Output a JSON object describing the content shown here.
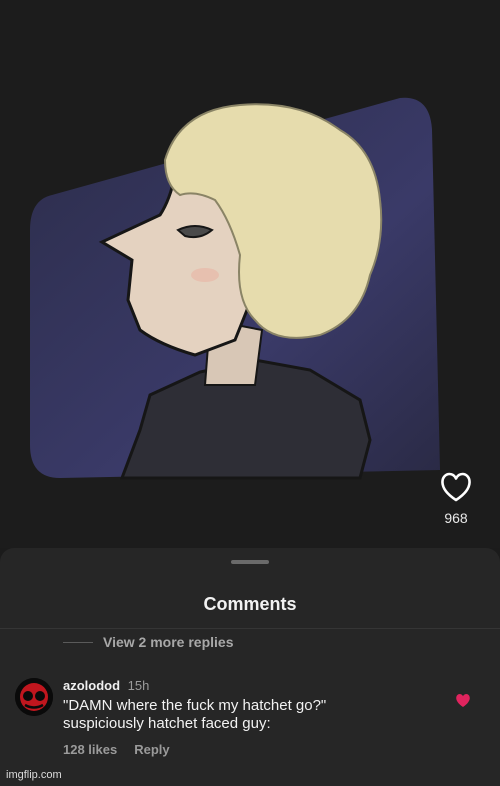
{
  "post": {
    "like_count": "968",
    "like_icon": "heart-outline-icon"
  },
  "comments_sheet": {
    "title": "Comments",
    "view_replies": "View 2 more replies"
  },
  "comment": {
    "username": "azolodod",
    "time": "15h",
    "text": "\"DAMN where the fuck my hatchet go?\"\nsuspiciously hatchet faced guy:",
    "likes": "128 likes",
    "reply_label": "Reply",
    "liked": true,
    "like_color": "#e0245e"
  },
  "watermark": "imgflip.com"
}
